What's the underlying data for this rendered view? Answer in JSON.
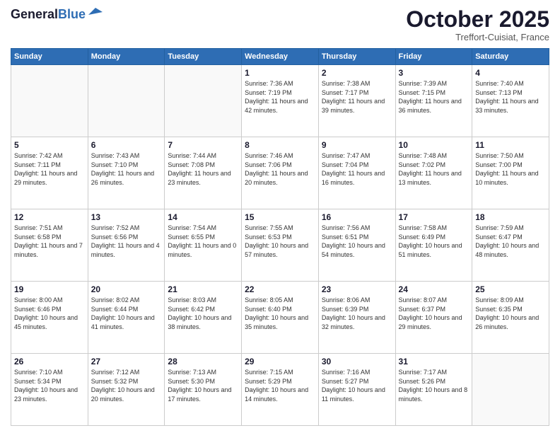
{
  "header": {
    "logo_line1": "General",
    "logo_line2": "Blue",
    "month": "October 2025",
    "location": "Treffort-Cuisiat, France"
  },
  "weekdays": [
    "Sunday",
    "Monday",
    "Tuesday",
    "Wednesday",
    "Thursday",
    "Friday",
    "Saturday"
  ],
  "weeks": [
    [
      {
        "day": "",
        "info": ""
      },
      {
        "day": "",
        "info": ""
      },
      {
        "day": "",
        "info": ""
      },
      {
        "day": "1",
        "info": "Sunrise: 7:36 AM\nSunset: 7:19 PM\nDaylight: 11 hours and 42 minutes."
      },
      {
        "day": "2",
        "info": "Sunrise: 7:38 AM\nSunset: 7:17 PM\nDaylight: 11 hours and 39 minutes."
      },
      {
        "day": "3",
        "info": "Sunrise: 7:39 AM\nSunset: 7:15 PM\nDaylight: 11 hours and 36 minutes."
      },
      {
        "day": "4",
        "info": "Sunrise: 7:40 AM\nSunset: 7:13 PM\nDaylight: 11 hours and 33 minutes."
      }
    ],
    [
      {
        "day": "5",
        "info": "Sunrise: 7:42 AM\nSunset: 7:11 PM\nDaylight: 11 hours and 29 minutes."
      },
      {
        "day": "6",
        "info": "Sunrise: 7:43 AM\nSunset: 7:10 PM\nDaylight: 11 hours and 26 minutes."
      },
      {
        "day": "7",
        "info": "Sunrise: 7:44 AM\nSunset: 7:08 PM\nDaylight: 11 hours and 23 minutes."
      },
      {
        "day": "8",
        "info": "Sunrise: 7:46 AM\nSunset: 7:06 PM\nDaylight: 11 hours and 20 minutes."
      },
      {
        "day": "9",
        "info": "Sunrise: 7:47 AM\nSunset: 7:04 PM\nDaylight: 11 hours and 16 minutes."
      },
      {
        "day": "10",
        "info": "Sunrise: 7:48 AM\nSunset: 7:02 PM\nDaylight: 11 hours and 13 minutes."
      },
      {
        "day": "11",
        "info": "Sunrise: 7:50 AM\nSunset: 7:00 PM\nDaylight: 11 hours and 10 minutes."
      }
    ],
    [
      {
        "day": "12",
        "info": "Sunrise: 7:51 AM\nSunset: 6:58 PM\nDaylight: 11 hours and 7 minutes."
      },
      {
        "day": "13",
        "info": "Sunrise: 7:52 AM\nSunset: 6:56 PM\nDaylight: 11 hours and 4 minutes."
      },
      {
        "day": "14",
        "info": "Sunrise: 7:54 AM\nSunset: 6:55 PM\nDaylight: 11 hours and 0 minutes."
      },
      {
        "day": "15",
        "info": "Sunrise: 7:55 AM\nSunset: 6:53 PM\nDaylight: 10 hours and 57 minutes."
      },
      {
        "day": "16",
        "info": "Sunrise: 7:56 AM\nSunset: 6:51 PM\nDaylight: 10 hours and 54 minutes."
      },
      {
        "day": "17",
        "info": "Sunrise: 7:58 AM\nSunset: 6:49 PM\nDaylight: 10 hours and 51 minutes."
      },
      {
        "day": "18",
        "info": "Sunrise: 7:59 AM\nSunset: 6:47 PM\nDaylight: 10 hours and 48 minutes."
      }
    ],
    [
      {
        "day": "19",
        "info": "Sunrise: 8:00 AM\nSunset: 6:46 PM\nDaylight: 10 hours and 45 minutes."
      },
      {
        "day": "20",
        "info": "Sunrise: 8:02 AM\nSunset: 6:44 PM\nDaylight: 10 hours and 41 minutes."
      },
      {
        "day": "21",
        "info": "Sunrise: 8:03 AM\nSunset: 6:42 PM\nDaylight: 10 hours and 38 minutes."
      },
      {
        "day": "22",
        "info": "Sunrise: 8:05 AM\nSunset: 6:40 PM\nDaylight: 10 hours and 35 minutes."
      },
      {
        "day": "23",
        "info": "Sunrise: 8:06 AM\nSunset: 6:39 PM\nDaylight: 10 hours and 32 minutes."
      },
      {
        "day": "24",
        "info": "Sunrise: 8:07 AM\nSunset: 6:37 PM\nDaylight: 10 hours and 29 minutes."
      },
      {
        "day": "25",
        "info": "Sunrise: 8:09 AM\nSunset: 6:35 PM\nDaylight: 10 hours and 26 minutes."
      }
    ],
    [
      {
        "day": "26",
        "info": "Sunrise: 7:10 AM\nSunset: 5:34 PM\nDaylight: 10 hours and 23 minutes."
      },
      {
        "day": "27",
        "info": "Sunrise: 7:12 AM\nSunset: 5:32 PM\nDaylight: 10 hours and 20 minutes."
      },
      {
        "day": "28",
        "info": "Sunrise: 7:13 AM\nSunset: 5:30 PM\nDaylight: 10 hours and 17 minutes."
      },
      {
        "day": "29",
        "info": "Sunrise: 7:15 AM\nSunset: 5:29 PM\nDaylight: 10 hours and 14 minutes."
      },
      {
        "day": "30",
        "info": "Sunrise: 7:16 AM\nSunset: 5:27 PM\nDaylight: 10 hours and 11 minutes."
      },
      {
        "day": "31",
        "info": "Sunrise: 7:17 AM\nSunset: 5:26 PM\nDaylight: 10 hours and 8 minutes."
      },
      {
        "day": "",
        "info": ""
      }
    ]
  ]
}
